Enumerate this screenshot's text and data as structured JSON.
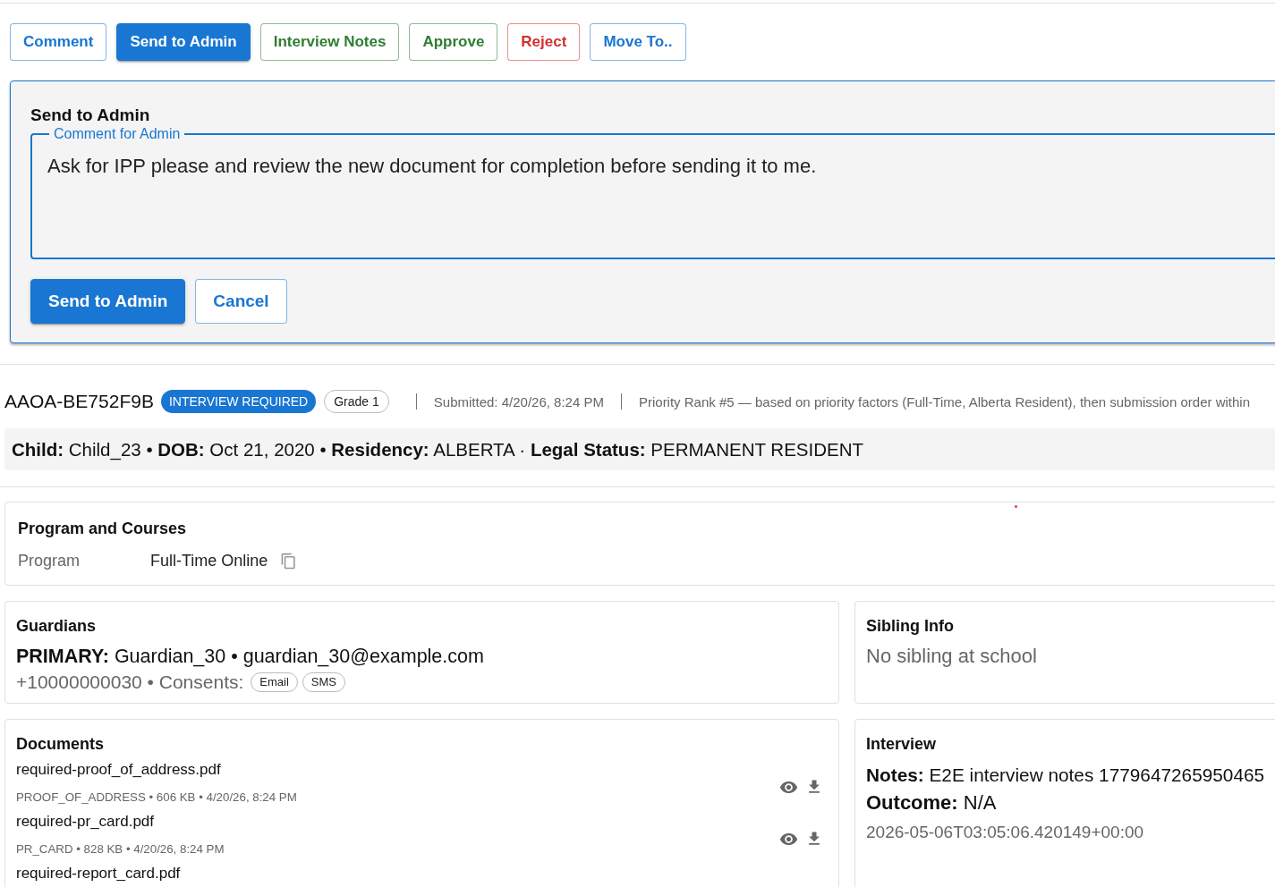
{
  "actions": [
    {
      "label": "Comment",
      "color": "#1976d2",
      "selected": false
    },
    {
      "label": "Send to Admin",
      "color": "#1976d2",
      "selected": true
    },
    {
      "label": "Interview Notes",
      "color": "#2e7d32",
      "selected": false
    },
    {
      "label": "Approve",
      "color": "#2e7d32",
      "selected": false
    },
    {
      "label": "Reject",
      "color": "#d32f2f",
      "selected": false
    },
    {
      "label": "Move To..",
      "color": "#1976d2",
      "selected": false
    }
  ],
  "admin_panel": {
    "title": "Send to Admin",
    "comment_field": {
      "label": "Comment for Admin",
      "value": "Ask for IPP please and review the new document for completion before sending it to me."
    },
    "buttons": [
      {
        "label": "Send to Admin",
        "kind": "primary"
      },
      {
        "label": "Cancel",
        "kind": "outlined"
      }
    ]
  },
  "application": {
    "id": "AAOA-BE752F9B",
    "status": "INTERVIEW REQUIRED",
    "grade": "Grade 1",
    "submitted": "Submitted: 4/20/26, 8:24 PM",
    "priority": "Priority Rank #5 — based on priority factors (Full-Time, Alberta Resident), then submission order within"
  },
  "summary": "**Child:** Child_23 • **DOB:** Oct 21, 2020 • **Residency:** ALBERTA · **Legal Status:** PERMANENT RESIDENT",
  "program_card": {
    "title": "Program and Courses",
    "rows": [
      {
        "label": "Program",
        "value": "Full-Time Online"
      }
    ]
  },
  "guardians": {
    "title": "Guardians",
    "primary": "**PRIMARY:** Guardian_30 • guardian_30@example.com",
    "contact": "+10000000030 • Consents:",
    "consents": [
      "Email",
      "SMS"
    ]
  },
  "sibling_info": {
    "title": "Sibling Info",
    "text": "No sibling at school"
  },
  "documents": {
    "title": "Documents",
    "items": [
      {
        "name": "required-proof_of_address.pdf",
        "meta": "PROOF_OF_ADDRESS • 606 KB • 4/20/26, 8:24 PM"
      },
      {
        "name": "required-pr_card.pdf",
        "meta": "PR_CARD • 828 KB • 4/20/26, 8:24 PM"
      },
      {
        "name": "required-report_card.pdf"
      }
    ]
  },
  "interview": {
    "title": "Interview",
    "notes": "**Notes:** E2E interview notes 1779647265950465",
    "outcome": "**Outcome:** N/A",
    "timestamp": "2026-05-06T03:05:06.420149+00:00"
  }
}
